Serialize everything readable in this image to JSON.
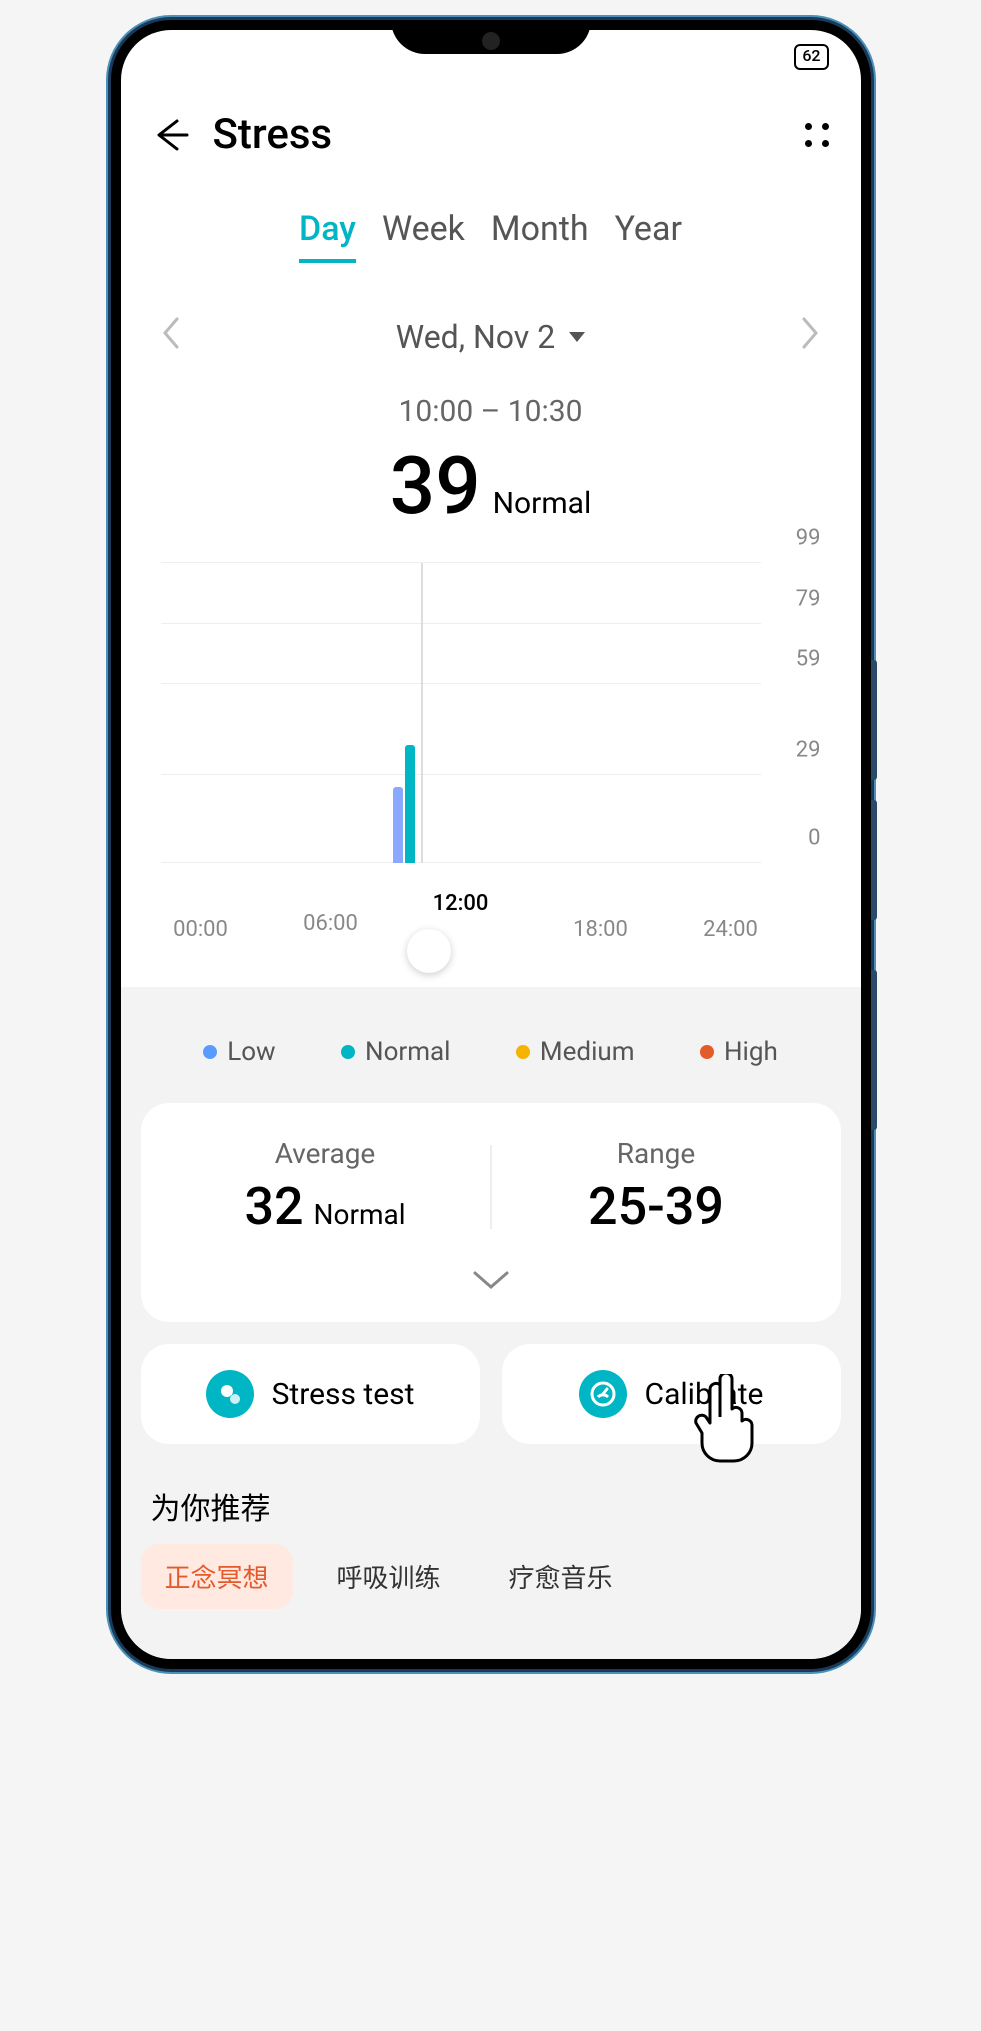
{
  "status_bar": {
    "battery": "62"
  },
  "header": {
    "title": "Stress"
  },
  "tabs": {
    "day": "Day",
    "week": "Week",
    "month": "Month",
    "year": "Year",
    "active": "day"
  },
  "date_nav": {
    "date": "Wed, Nov 2"
  },
  "reading": {
    "time_range": "10:00 – 10:30",
    "value": "39",
    "status": "Normal"
  },
  "chart_data": {
    "type": "bar",
    "y_ticks": [
      0,
      29,
      59,
      79,
      99
    ],
    "y_max": 99,
    "x_labels": [
      "00:00",
      "06:00",
      "12:00",
      "18:00",
      "24:00"
    ],
    "selected_x": "12:00",
    "bars": [
      {
        "x_hour": 10.0,
        "value": 25,
        "color": "#8aa8ff"
      },
      {
        "x_hour": 10.5,
        "value": 39,
        "color": "#00b5c4"
      }
    ]
  },
  "legend": {
    "low": {
      "label": "Low",
      "color": "#5a9bff"
    },
    "normal": {
      "label": "Normal",
      "color": "#00b5c4"
    },
    "medium": {
      "label": "Medium",
      "color": "#f5b400"
    },
    "high": {
      "label": "High",
      "color": "#e55a2b"
    }
  },
  "stats": {
    "average": {
      "label": "Average",
      "value": "32",
      "status": "Normal"
    },
    "range": {
      "label": "Range",
      "value": "25-39"
    }
  },
  "actions": {
    "stress_test": "Stress test",
    "calibrate": "Calibrate"
  },
  "recommend": {
    "title": "为你推荐",
    "tabs": {
      "mindful": "正念冥想",
      "breath": "呼吸训练",
      "music": "疗愈音乐"
    }
  }
}
